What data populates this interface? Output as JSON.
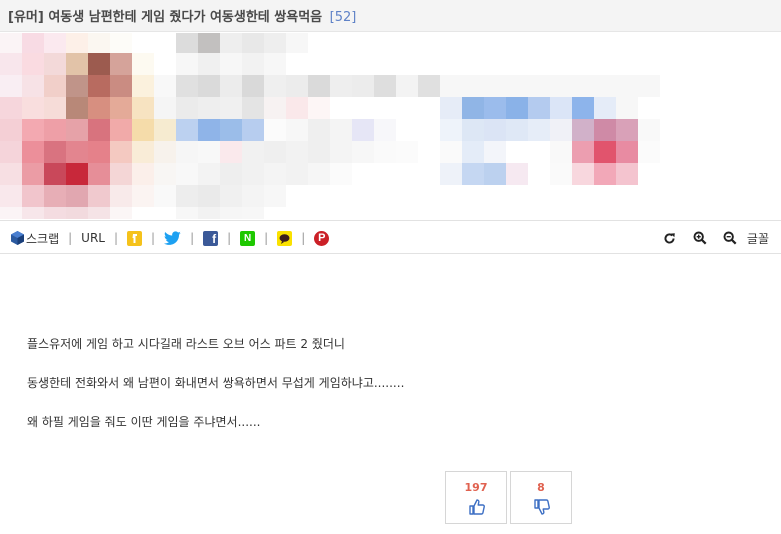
{
  "post": {
    "category": "[유머]",
    "title": "여동생 남편한테 게임 줬다가 여동생한테 쌍욕먹음",
    "comment_count": "[52]"
  },
  "image": {
    "alt": "blurred/mosaic image"
  },
  "share_bar": {
    "scrap_label": "스크랩",
    "url_label": "URL",
    "separator": "|",
    "icons": [
      "scrap-icon",
      "kakaostory-icon",
      "twitter-icon",
      "facebook-icon",
      "naver-icon",
      "kakaotalk-icon",
      "pinterest-icon"
    ],
    "facebook_glyph": "f",
    "naver_glyph": "N",
    "pinterest_glyph": "P",
    "font_label": "글꼴",
    "tools": [
      "refresh-icon",
      "zoom-in-icon",
      "zoom-out-icon"
    ]
  },
  "content": {
    "paragraphs": [
      "플스유저에 게임 하고 시다길래 라스트 오브 어스 파트 2 줬더니",
      "동생한테 전화와서 왜 남편이 화내면서 쌍욕하면서 무섭게 게임하냐고........",
      "왜 하필 게임을 줘도 이딴 게임을 주냐면서......"
    ]
  },
  "votes": {
    "up": "197",
    "down": "8"
  },
  "colors": {
    "vote_count": "#e0614f",
    "thumb_icon": "#3d6fc4",
    "comment_count": "#5f82c7"
  }
}
